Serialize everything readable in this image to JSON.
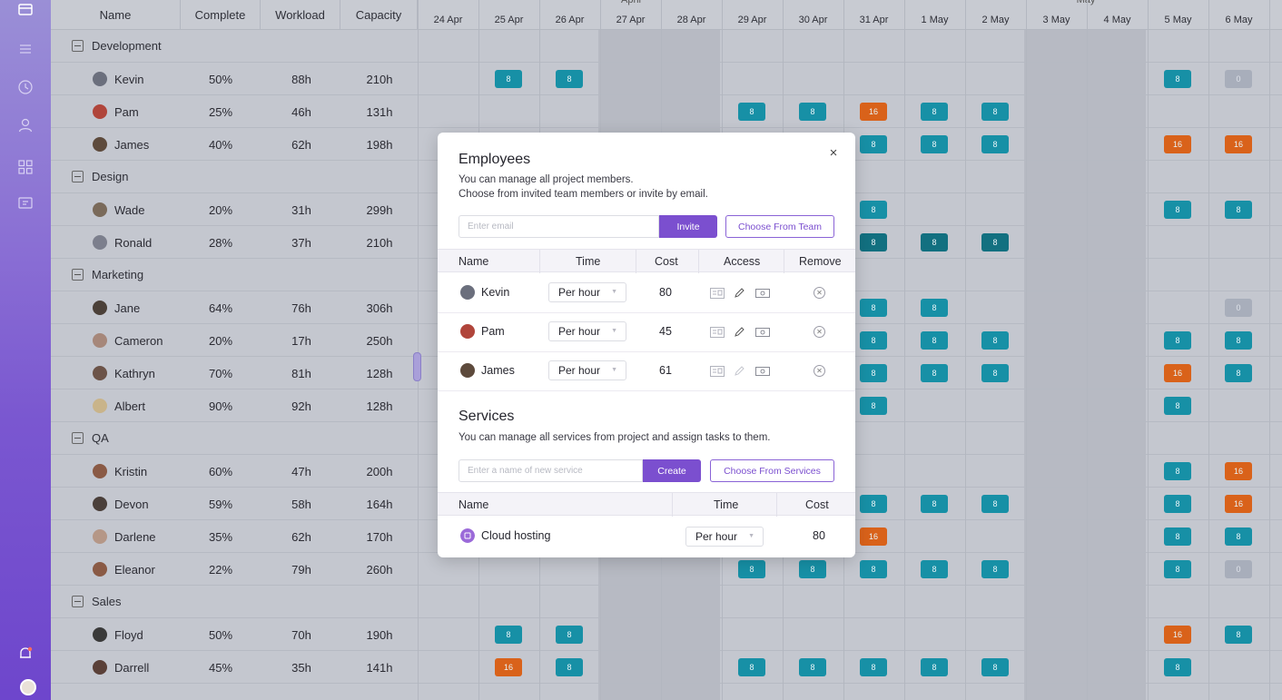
{
  "colors": {
    "accent": "#7b4fcf",
    "teal": "#1790a6",
    "orange": "#d9621a",
    "gray": "#a8aebb"
  },
  "sidebar": {
    "icons": [
      "folder-icon",
      "list-icon",
      "clock-icon",
      "user-icon",
      "grid-icon",
      "message-icon",
      "bell-icon"
    ]
  },
  "grid": {
    "columns": {
      "name": "Name",
      "complete": "Complete",
      "workload": "Workload",
      "capacity": "Capacity"
    },
    "months": [
      "April",
      "May"
    ],
    "days": [
      "24 Apr",
      "25 Apr",
      "26 Apr",
      "27 Apr",
      "28 Apr",
      "29 Apr",
      "30 Apr",
      "31 Apr",
      "1 May",
      "2 May",
      "3 May",
      "4 May",
      "5 May",
      "6 May"
    ],
    "groups": [
      {
        "name": "Development",
        "members": [
          {
            "name": "Kevin",
            "complete": "50%",
            "workload": "88h",
            "capacity": "210h"
          },
          {
            "name": "Pam",
            "complete": "25%",
            "workload": "46h",
            "capacity": "131h"
          },
          {
            "name": "James",
            "complete": "40%",
            "workload": "62h",
            "capacity": "198h"
          }
        ]
      },
      {
        "name": "Design",
        "members": [
          {
            "name": "Wade",
            "complete": "20%",
            "workload": "31h",
            "capacity": "299h"
          },
          {
            "name": "Ronald",
            "complete": "28%",
            "workload": "37h",
            "capacity": "210h"
          }
        ]
      },
      {
        "name": "Marketing",
        "members": [
          {
            "name": "Jane",
            "complete": "64%",
            "workload": "76h",
            "capacity": "306h"
          },
          {
            "name": "Cameron",
            "complete": "20%",
            "workload": "17h",
            "capacity": "250h"
          },
          {
            "name": "Kathryn",
            "complete": "70%",
            "workload": "81h",
            "capacity": "128h"
          },
          {
            "name": "Albert",
            "complete": "90%",
            "workload": "92h",
            "capacity": "128h"
          }
        ]
      },
      {
        "name": "QA",
        "members": [
          {
            "name": "Kristin",
            "complete": "60%",
            "workload": "47h",
            "capacity": "200h"
          },
          {
            "name": "Devon",
            "complete": "59%",
            "workload": "58h",
            "capacity": "164h"
          },
          {
            "name": "Darlene",
            "complete": "35%",
            "workload": "62h",
            "capacity": "170h"
          },
          {
            "name": "Eleanor",
            "complete": "22%",
            "workload": "79h",
            "capacity": "260h"
          }
        ]
      },
      {
        "name": "Sales",
        "members": [
          {
            "name": "Floyd",
            "complete": "50%",
            "workload": "70h",
            "capacity": "190h"
          },
          {
            "name": "Darrell",
            "complete": "45%",
            "workload": "35h",
            "capacity": "141h"
          }
        ]
      }
    ],
    "badge_values": {
      "regular": "8",
      "overtime": "16",
      "none": "0"
    }
  },
  "modal": {
    "employees_title": "Employees",
    "employees_desc1": "You can manage all project members.",
    "employees_desc2": "Choose from invited team members or invite by email.",
    "email_placeholder": "Enter email",
    "invite_label": "Invite",
    "choose_team_label": "Choose From Team",
    "emp_headers": {
      "name": "Name",
      "time": "Time",
      "cost": "Cost",
      "access": "Access",
      "remove": "Remove"
    },
    "employees": [
      {
        "name": "Kevin",
        "time": "Per hour",
        "cost": "80"
      },
      {
        "name": "Pam",
        "time": "Per hour",
        "cost": "45"
      },
      {
        "name": "James",
        "time": "Per hour",
        "cost": "61"
      }
    ],
    "services_title": "Services",
    "services_desc": "You can manage all services from project and assign tasks to them.",
    "service_placeholder": "Enter a name of new service",
    "create_label": "Create",
    "choose_services_label": "Choose From Services",
    "svc_headers": {
      "name": "Name",
      "time": "Time",
      "cost": "Cost"
    },
    "services": [
      {
        "name": "Cloud hosting",
        "time": "Per hour",
        "cost": "80"
      }
    ],
    "close_glyph": "×"
  }
}
